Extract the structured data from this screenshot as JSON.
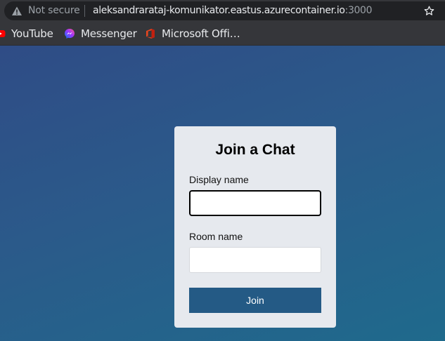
{
  "browser": {
    "security_label": "Not secure",
    "url_host": "aleksandrarataj-komunikator.eastus.azurecontainer.io",
    "url_port": ":3000",
    "bookmarks": [
      {
        "label": "YouTube",
        "icon": "youtube-icon"
      },
      {
        "label": "Messenger",
        "icon": "messenger-icon"
      },
      {
        "label": "Microsoft Offi…",
        "icon": "microsoft-office-icon"
      }
    ]
  },
  "form": {
    "title": "Join a Chat",
    "display_name_label": "Display name",
    "display_name_value": "",
    "room_name_label": "Room name",
    "room_name_value": "",
    "join_label": "Join"
  },
  "colors": {
    "accent": "#245a85",
    "card_background": "#e6e9ee"
  }
}
